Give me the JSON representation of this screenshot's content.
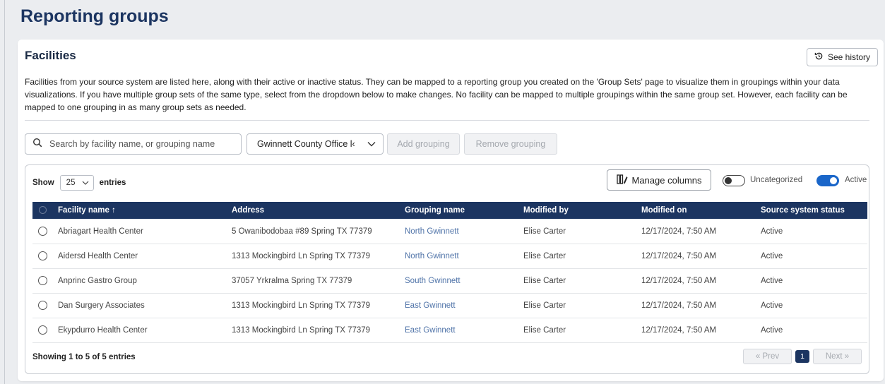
{
  "page": {
    "title": "Reporting groups"
  },
  "card": {
    "title": "Facilities",
    "history_label": "See history",
    "description": "Facilities from your source system are listed here, along with their active or inactive status. They can be mapped to a reporting group you created on the 'Group Sets' page to visualize them in groupings within your data visualizations. If you have multiple group sets of the same type, select from the dropdown below to make changes. No facility can be mapped to multiple groupings within the same group set. However, each facility can be mapped to one grouping in as many group sets as needed."
  },
  "toolbar": {
    "search_placeholder": "Search by facility name, or grouping name",
    "group_set_selected": "Gwinnett County Office l‹",
    "add_label": "Add grouping",
    "remove_label": "Remove grouping"
  },
  "table_controls": {
    "show_label": "Show",
    "page_size": "25",
    "entries_label": "entries",
    "manage_columns_label": "Manage columns",
    "uncategorized_label": "Uncategorized",
    "uncategorized_on": false,
    "active_label": "Active",
    "active_on": true,
    "accent_color": "#1a66c9"
  },
  "columns": [
    "Facility name ↑",
    "Address",
    "Grouping name",
    "Modified by",
    "Modified on",
    "Source system status"
  ],
  "rows": [
    {
      "facility": "Abriagart Health Center",
      "address": "5 Owanibodobaa #89 Spring TX 77379",
      "grouping": "North Gwinnett",
      "modified_by": "Elise Carter",
      "modified_on": "12/17/2024, 7:50 AM",
      "status": "Active"
    },
    {
      "facility": "Aidersd Health Center",
      "address": "1313 Mockingbird Ln Spring TX 77379",
      "grouping": "North Gwinnett",
      "modified_by": "Elise Carter",
      "modified_on": "12/17/2024, 7:50 AM",
      "status": "Active"
    },
    {
      "facility": "Anprinc Gastro Group",
      "address": "37057 Yrkralma Spring TX 77379",
      "grouping": "South Gwinnett",
      "modified_by": "Elise Carter",
      "modified_on": "12/17/2024, 7:50 AM",
      "status": "Active"
    },
    {
      "facility": "Dan Surgery Associates",
      "address": "1313 Mockingbird Ln Spring TX 77379",
      "grouping": "East Gwinnett",
      "modified_by": "Elise Carter",
      "modified_on": "12/17/2024, 7:50 AM",
      "status": "Active"
    },
    {
      "facility": "Ekypdurro Health Center",
      "address": "1313 Mockingbird Ln Spring TX 77379",
      "grouping": "East Gwinnett",
      "modified_by": "Elise Carter",
      "modified_on": "12/17/2024, 7:50 AM",
      "status": "Active"
    }
  ],
  "footer": {
    "info": "Showing 1 to 5 of 5 entries",
    "prev_label": "« Prev",
    "page": "1",
    "next_label": "Next »"
  },
  "colors": {
    "navy": "#1c3561",
    "link": "#4f73a8"
  }
}
